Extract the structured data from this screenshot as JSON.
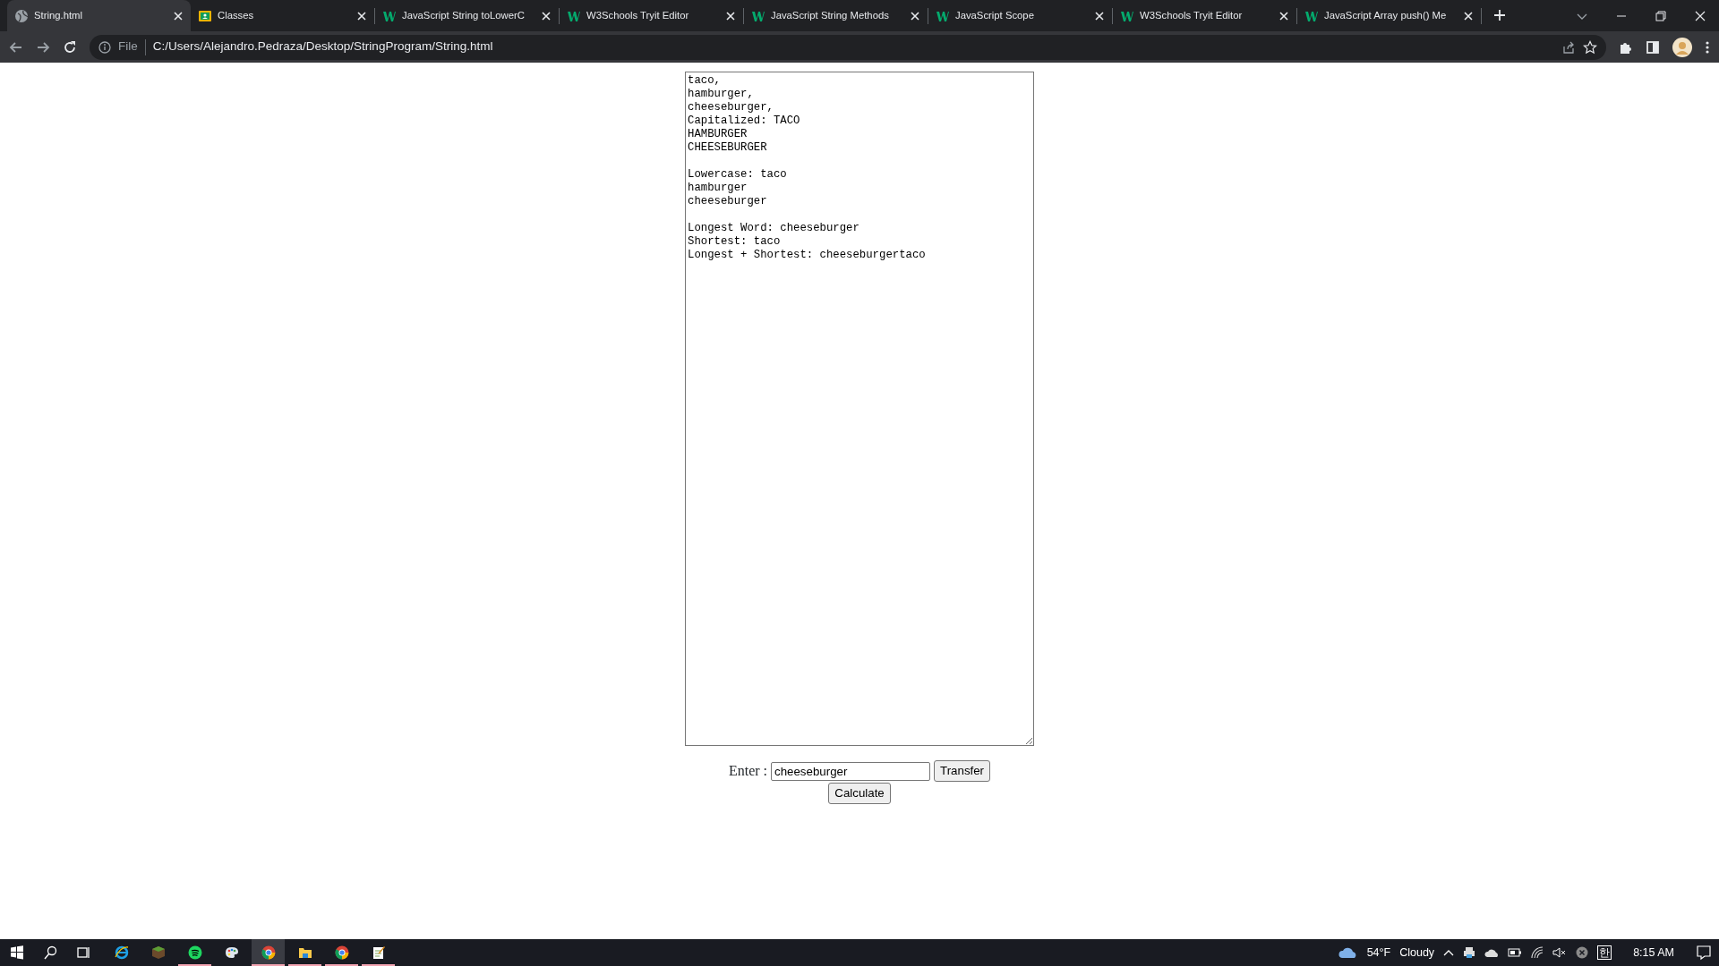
{
  "tabs": [
    {
      "title": "String.html",
      "kind": "globe",
      "selected": true
    },
    {
      "title": "Classes",
      "kind": "classroom",
      "selected": false
    },
    {
      "title": "JavaScript String toLowerC",
      "kind": "w3schools",
      "selected": false
    },
    {
      "title": "W3Schools Tryit Editor",
      "kind": "w3schools",
      "selected": false
    },
    {
      "title": "JavaScript String Methods",
      "kind": "w3schools",
      "selected": false
    },
    {
      "title": "JavaScript Scope",
      "kind": "w3schools",
      "selected": false
    },
    {
      "title": "W3Schools Tryit Editor",
      "kind": "w3schools",
      "selected": false
    },
    {
      "title": "JavaScript Array push() Me",
      "kind": "w3schools",
      "selected": false
    }
  ],
  "address_bar": {
    "scheme_label": "File",
    "url": "C:/Users/Alejandro.Pedraza/Desktop/StringProgram/String.html"
  },
  "page": {
    "output": "taco,\nhamburger,\ncheeseburger,\nCapitalized: TACO\nHAMBURGER\nCHEESEBURGER\n\nLowercase: taco\nhamburger\ncheeseburger\n\nLongest Word: cheeseburger\nShortest: taco\nLongest + Shortest: cheeseburgertaco",
    "enter_label": "Enter :",
    "input_value": "cheeseburger",
    "transfer_button": "Transfer",
    "calculate_button": "Calculate"
  },
  "taskbar": {
    "apps": [
      {
        "kind": "ie",
        "running": false,
        "selected": false
      },
      {
        "kind": "minecraft",
        "running": false,
        "selected": false
      },
      {
        "kind": "spotify",
        "running": true,
        "selected": false
      },
      {
        "kind": "paint",
        "running": false,
        "selected": false
      },
      {
        "kind": "chrome",
        "running": true,
        "selected": true
      },
      {
        "kind": "explorer",
        "running": true,
        "selected": false
      },
      {
        "kind": "chrome",
        "running": true,
        "selected": false
      },
      {
        "kind": "notepad",
        "running": true,
        "selected": false
      }
    ],
    "temperature": "54°F",
    "weather": "Cloudy",
    "ime": "한",
    "time": "8:15 AM"
  }
}
